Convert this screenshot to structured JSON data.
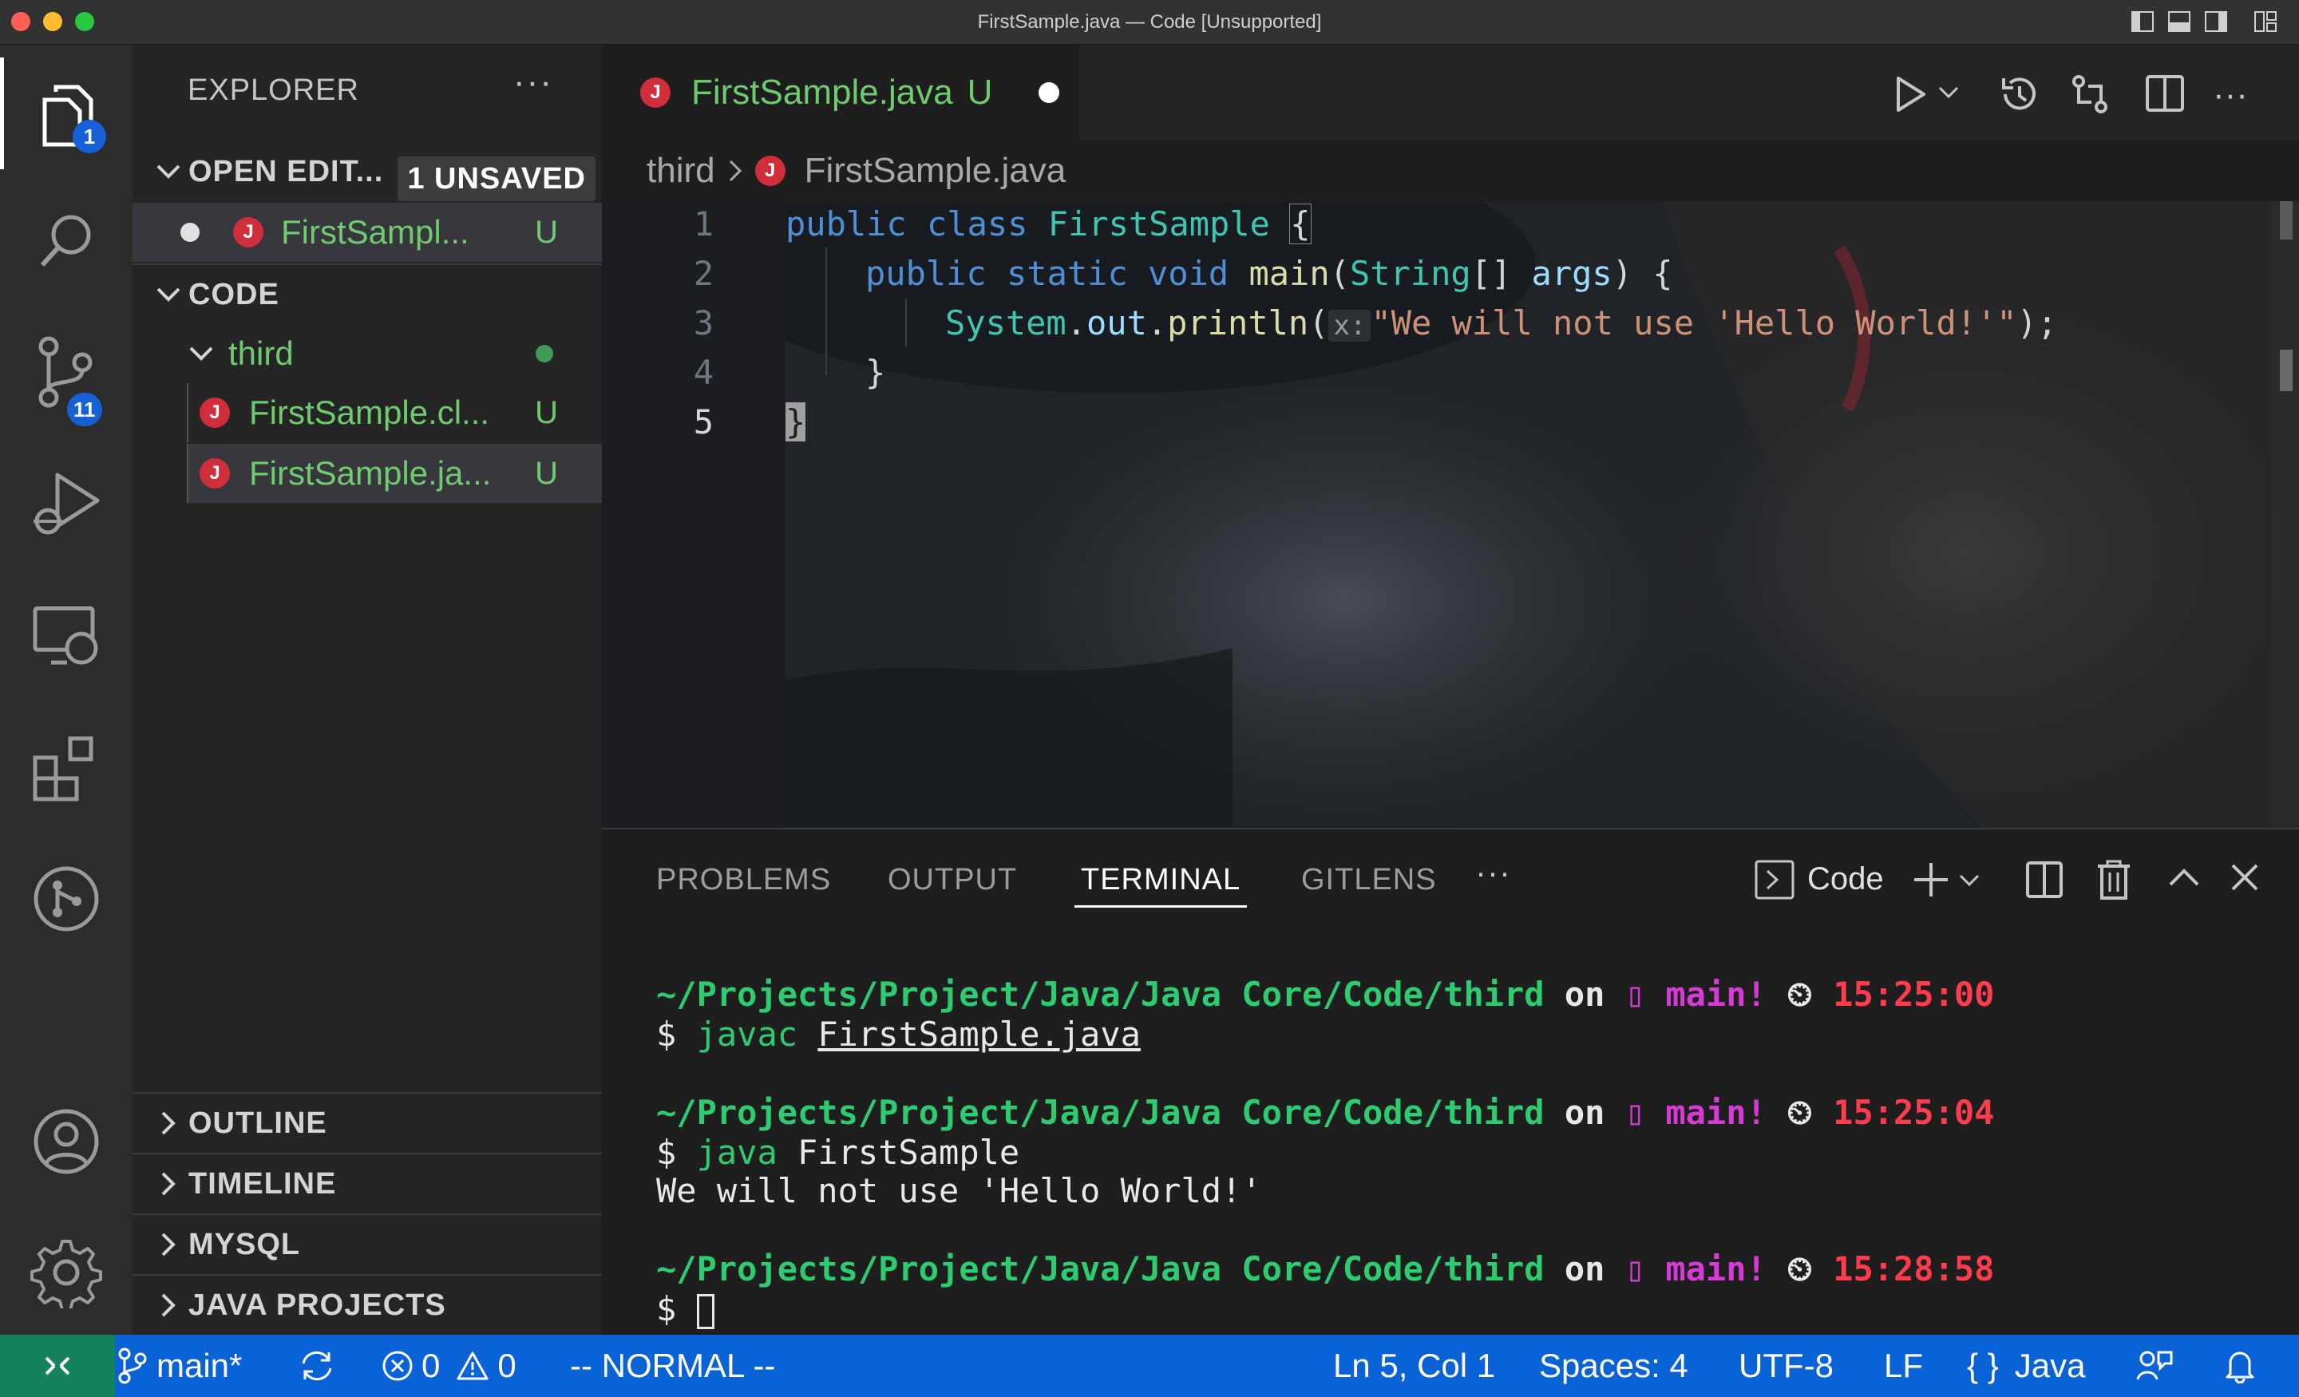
{
  "window": {
    "title": "FirstSample.java — Code [Unsupported]"
  },
  "activity": {
    "explorer_badge": "1",
    "scm_badge": "11"
  },
  "sidebar": {
    "title": "EXPLORER",
    "more": "···",
    "open_editors": {
      "label": "OPEN EDIT...",
      "badge": "1 UNSAVED",
      "file": "FirstSampl...",
      "status": "U"
    },
    "code": {
      "label": "CODE",
      "folder": "third",
      "files": [
        {
          "icon": "J",
          "name": "FirstSample.cl...",
          "status": "U"
        },
        {
          "icon": "J",
          "name": "FirstSample.ja...",
          "status": "U"
        }
      ]
    },
    "bottom_sections": [
      "OUTLINE",
      "TIMELINE",
      "MYSQL",
      "JAVA PROJECTS"
    ]
  },
  "editor": {
    "tab": {
      "icon": "J",
      "name": "FirstSample.java",
      "status": "U"
    },
    "breadcrumb": {
      "folder": "third",
      "file": "FirstSample.java"
    },
    "line_numbers": [
      "1",
      "2",
      "3",
      "4",
      "5"
    ],
    "code": {
      "l1_kw1": "public",
      "l1_kw2": "class",
      "l1_cls": "FirstSample",
      "l1_br": "{",
      "l2_kw1": "public",
      "l2_kw2": "static",
      "l2_kw3": "void",
      "l2_fn": "main",
      "l2_p1": "(",
      "l2_cls": "String",
      "l2_p2": "[]",
      "l2_var": "args",
      "l2_p3": ") {",
      "l3_cls": "System",
      "l3_dot1": ".",
      "l3_var": "out",
      "l3_dot2": ".",
      "l3_fn": "println",
      "l3_p1": "(",
      "l3_hint": "x:",
      "l3_str": "\"We will not use 'Hello World!'\"",
      "l3_p2": ");",
      "l4": "}",
      "l5": "}"
    }
  },
  "panel": {
    "tabs": [
      "PROBLEMS",
      "OUTPUT",
      "TERMINAL",
      "GITLENS"
    ],
    "more": "···",
    "terminal_name": "Code",
    "terminal": [
      {
        "path": "~/Projects/Project/Java/Java Core/Code/third",
        "on": "on",
        "branch_glyph": "▯",
        "branch": "main!",
        "clock": "⏲",
        "time": "15:25:00",
        "prompt": "$",
        "cmd": "javac",
        "arg": "FirstSample.java",
        "output": ""
      },
      {
        "path": "~/Projects/Project/Java/Java Core/Code/third",
        "on": "on",
        "branch_glyph": "▯",
        "branch": "main!",
        "clock": "⏲",
        "time": "15:25:04",
        "prompt": "$",
        "cmd": "java",
        "arg": "FirstSample",
        "output": "We will not use 'Hello World!'"
      },
      {
        "path": "~/Projects/Project/Java/Java Core/Code/third",
        "on": "on",
        "branch_glyph": "▯",
        "branch": "main!",
        "clock": "⏲",
        "time": "15:28:58",
        "prompt": "$",
        "cmd": "",
        "arg": "",
        "output": ""
      }
    ]
  },
  "statusbar": {
    "branch": "main*",
    "errors": "0",
    "warnings": "0",
    "mode": "-- NORMAL --",
    "position": "Ln 5, Col 1",
    "spaces": "Spaces: 4",
    "encoding": "UTF-8",
    "eol": "LF",
    "language_braces": "{ }",
    "language": "Java"
  },
  "colors": {
    "accent": "#0a63d6",
    "remote": "#16825d",
    "java_icon": "#d02e3b",
    "untracked": "#6ecb6e",
    "terminal_path": "#2ecc71",
    "terminal_branch": "#d63bd6",
    "terminal_time": "#ff3b4e"
  }
}
